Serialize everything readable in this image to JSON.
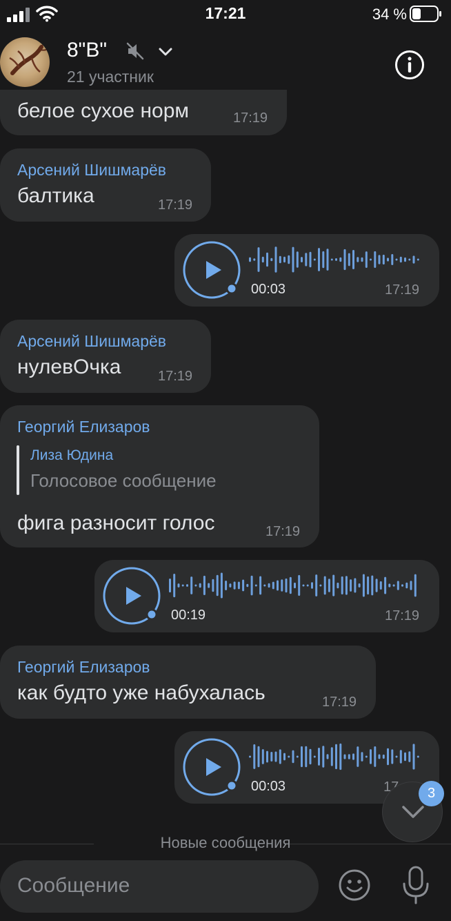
{
  "status_bar": {
    "time": "17:21",
    "battery_text": "34 %"
  },
  "header": {
    "title": "8\"В\"",
    "subtitle": "21 участник"
  },
  "messages": [
    {
      "text": "белое сухое норм",
      "time": "17:19"
    },
    {
      "sender": "Арсений Шишмарёв",
      "text": "балтика",
      "time": "17:19"
    },
    {
      "type": "voice",
      "duration": "00:03",
      "time": "17:19"
    },
    {
      "sender": "Арсений Шишмарёв",
      "text": "нулевОчка",
      "time": "17:19"
    },
    {
      "sender": "Георгий Елизаров",
      "reply_name": "Лиза Юдина",
      "reply_text": "Голосовое сообщение",
      "text": "фига разносит голос",
      "time": "17:19"
    },
    {
      "type": "voice",
      "duration": "00:19",
      "time": "17:19"
    },
    {
      "sender": "Георгий Елизаров",
      "text": "как будто уже набухалась",
      "time": "17:19"
    },
    {
      "type": "voice",
      "duration": "00:03",
      "time": "17"
    }
  ],
  "new_messages_label": "Новые сообщения",
  "scroll_badge": "3",
  "composer": {
    "placeholder": "Сообщение"
  },
  "colors": {
    "background": "#19191a",
    "bubble": "#2c2d2e",
    "accent": "#71aaeb",
    "wave": "#6d9fdc"
  },
  "icons": [
    "signal-icon",
    "wifi-icon",
    "battery-icon",
    "mute-icon",
    "chevron-down-icon",
    "info-icon",
    "play-icon",
    "emoji-icon",
    "mic-icon"
  ]
}
